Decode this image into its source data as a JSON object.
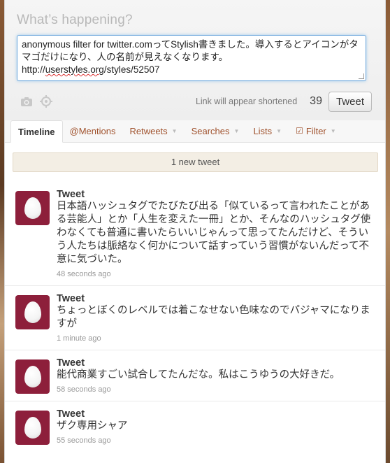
{
  "compose": {
    "title": "What’s happening?",
    "text_before_link": "anonymous filter for twitter.comってStylish書きました。導入するとアイコンがタマゴだけになり、人の名前が見えなくなります。 http://",
    "link_text": "userstyles.org",
    "text_after_link": "/styles/52507",
    "link_note": "Link will appear shortened",
    "char_count": "39",
    "tweet_button": "Tweet",
    "icons": [
      "camera-icon",
      "location-target-icon"
    ]
  },
  "tabs": [
    {
      "label": "Timeline",
      "active": true
    },
    {
      "label": "@Mentions"
    },
    {
      "label": "Retweets"
    },
    {
      "label": "Searches"
    },
    {
      "label": "Lists"
    },
    {
      "label": "Filter"
    }
  ],
  "notice": "1 new tweet",
  "tweets": [
    {
      "name": "Tweet",
      "text": "日本語ハッシュタグでたびたび出る「似ているって言われたことがある芸能人」とか「人生を変えた一冊」とか、そんなのハッシュタグ使わなくても普通に書いたらいいじゃんって思ってたんだけど、そういう人たちは脈絡なく何かについて話すっていう習慣がないんだって不意に気づいた。",
      "time": "48 seconds ago"
    },
    {
      "name": "Tweet",
      "text": "ちょっとぼくのレベルでは着こなせない色味なのでパジャマになりますが",
      "time": "1 minute ago"
    },
    {
      "name": "Tweet",
      "text": "能代商業すごい試合してたんだな。私はこうゆうの大好きだ。",
      "time": "58 seconds ago"
    },
    {
      "name": "Tweet",
      "text": "ザク専用シャア",
      "time": "55 seconds ago"
    }
  ],
  "colors": {
    "avatar_bg": "#8d1f3b",
    "tab_link": "#a0522d",
    "notice_bg": "#f3eee4",
    "focus_border": "#6fa8dc"
  }
}
